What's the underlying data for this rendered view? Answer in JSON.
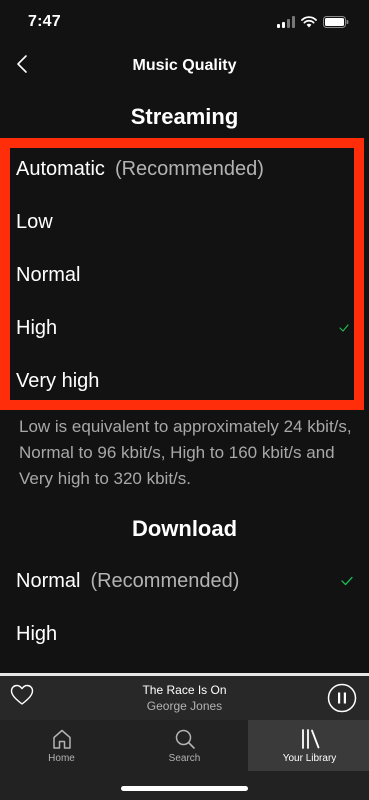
{
  "status_bar": {
    "time": "7:47"
  },
  "header": {
    "title": "Music Quality"
  },
  "streaming": {
    "title": "Streaming",
    "options": [
      {
        "label": "Automatic",
        "sub": "(Recommended)",
        "selected": false
      },
      {
        "label": "Low",
        "selected": false
      },
      {
        "label": "Normal",
        "selected": false
      },
      {
        "label": "High",
        "selected": true
      },
      {
        "label": "Very high",
        "selected": false
      }
    ],
    "description": "Low is equivalent to approximately 24 kbit/s, Normal to 96 kbit/s, High to 160 kbit/s and Very high to 320 kbit/s."
  },
  "download": {
    "title": "Download",
    "options": [
      {
        "label": "Normal",
        "sub": "(Recommended)",
        "selected": true
      },
      {
        "label": "High",
        "selected": false
      }
    ]
  },
  "now_playing": {
    "title": "The Race Is On",
    "artist": "George Jones",
    "progress": 1.0
  },
  "tabs": [
    {
      "label": "Home",
      "icon": "home-icon",
      "active": false
    },
    {
      "label": "Search",
      "icon": "search-icon",
      "active": false
    },
    {
      "label": "Your Library",
      "icon": "library-icon",
      "active": true
    }
  ],
  "colors": {
    "background": "#121212",
    "highlight": "#ff2d0a",
    "check": "#1db954",
    "secondary_text": "#b3b3b3"
  }
}
